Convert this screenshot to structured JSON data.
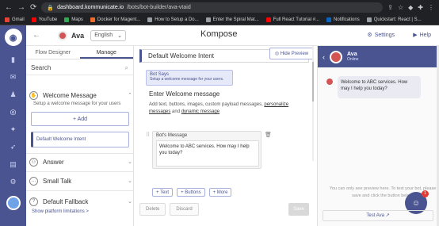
{
  "browser": {
    "url_host": "dashboard.kommunicate.io",
    "url_path": "/bots/bot-builder/ava-vtaid",
    "bookmarks": [
      "Gmail",
      "YouTube",
      "Maps",
      "Docker for Magent...",
      "How to Setup a Do...",
      "Enter the Spiral Mat...",
      "Full React Tutorial #...",
      "Notifications",
      "Quickstart: React | S..."
    ]
  },
  "header": {
    "bot_name": "Ava",
    "language": "English",
    "title": "Kompose",
    "settings": "Settings",
    "help": "Help"
  },
  "left_panel": {
    "tabs": [
      "Flow Designer",
      "Manage"
    ],
    "search_label": "Search",
    "welcome": {
      "title": "Welcome Message",
      "subtitle": "Setup a welcome message for your users",
      "add_label": "+ Add",
      "intent": "Default Welcome Intent"
    },
    "sections": [
      "Answer",
      "Small Talk",
      "Default Fallback"
    ],
    "limits_link": "Show platform limitations >"
  },
  "center": {
    "intent_title": "Default Welcome Intent",
    "hide_preview": "Hide Preview",
    "bot_says_title": "Bot Says",
    "bot_says_sub": "Setup a welcome message for your users.",
    "enter_label": "Enter Welcome message",
    "desc_pre": "Add text, buttons, images, custom payload messages,",
    "desc_link1": "personalize messages",
    "desc_mid": "and",
    "desc_link2": "dynamic message",
    "bot_message_label": "Bot's Message",
    "bot_message_text": "Welcome to ABC services. How may I help you today?",
    "add_text": "+ Text",
    "add_buttons": "+ Buttons",
    "add_more": "+ More",
    "delete": "Delete",
    "discard": "Discard",
    "save": "Save"
  },
  "preview": {
    "bot_name": "Ava",
    "status": "Online",
    "message": "Welcome to ABC services. How may I help you today?",
    "note": "You can only see preview here. To test your bot, please save and click the button below.",
    "test_label": "Test Ava ↗",
    "badge": "1"
  }
}
